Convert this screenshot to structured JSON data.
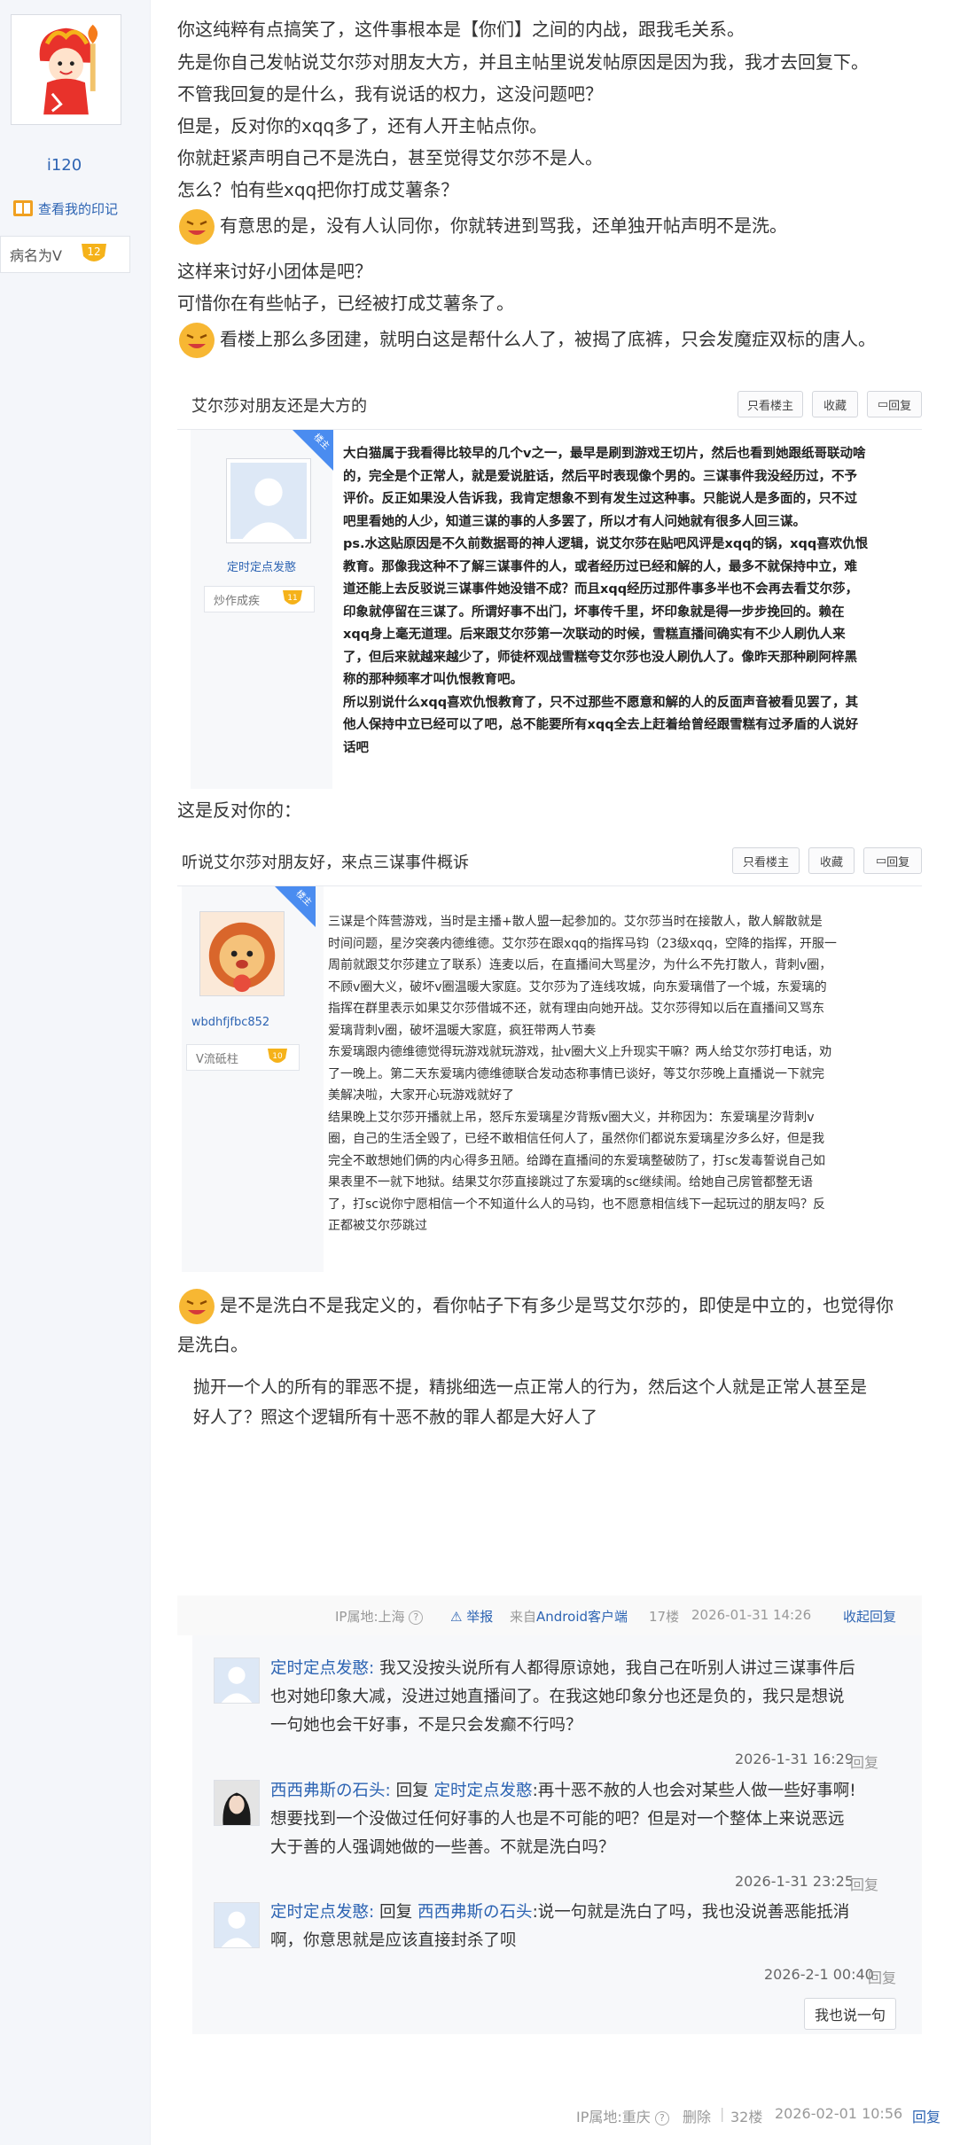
{
  "sidebar": {
    "username": "i120",
    "my_mark_link": "查看我的印记",
    "rank_title": "病名为V",
    "rank_level": "12"
  },
  "post": {
    "paragraphs": [
      "你这纯粹有点搞笑了，这件事根本是【你们】之间的内战，跟我毛关系。",
      "先是你自己发帖说艾尔莎对朋友大方，并且主帖里说发帖原因是因为我，我才去回复下。",
      "不管我回复的是什么，我有说话的权力，这没问题吧？",
      "但是，反对你的xqq多了，还有人开主帖点你。",
      "你就赶紧声明自己不是洗白，甚至觉得艾尔莎不是人。",
      "怎么？怕有些xqq把你打成艾薯条？",
      "有意思的是，没有人认同你，你就转进到骂我，还单独开帖声明不是洗。",
      "这样来讨好小团体是吧？",
      "可惜你在有些帖子，已经被打成艾薯条了。",
      "看楼上那么多团建，就明白这是帮什么人了，被揭了底裤，只会发魔症双标的唐人。",
      "这是反对你的：",
      "是不是洗白不是我定义的，看你帖子下有多少是骂艾尔莎的，即使是中立的，也觉得你",
      "是洗白。"
    ],
    "shot1": {
      "title": "艾尔莎对朋友还是大方的",
      "btn_owner": "只看楼主",
      "btn_fav": "收藏",
      "btn_reply": "回复",
      "ribbon": "楼主",
      "author": "定时定点发憨",
      "rank": "炒作成疾",
      "level": "11",
      "body": "大白猫属于我看得比较早的几个v之一，最早是刷到游戏王切片，然后也看到她跟纸哥联动啥\n的，完全是个正常人，就是爱说脏话，然后平时表现像个男的。三谋事件我没经历过，不予\n评价。反正如果没人告诉我，我肯定想象不到有发生过这种事。只能说人是多面的，只不过\n吧里看她的人少，知道三谋的事的人多罢了，所以才有人问她就有很多人回三谋。\nps.水这贴原因是不久前数据哥的神人逻辑，说艾尔莎在贴吧风评是xqq的锅，xqq喜欢仇恨\n教育。那像我这种不了解三谋事件的人，或者经历过已经和解的人，最多不就保持中立，难\n道还能上去反驳说三谋事件她没错不成？而且xqq经历过那件事多半也不会再去看艾尔莎，\n印象就停留在三谋了。所谓好事不出门，坏事传千里，坏印象就是得一步步挽回的。赖在\nxqq身上毫无道理。后来跟艾尔莎第一次联动的时候，雪糕直播间确实有不少人刷仇人来\n了，但后来就越来越少了，师徒杯观战雪糕夸艾尔莎也没人刷仇人了。像昨天那种刷阿梓黑\n称的那种频率才叫仇恨教育吧。\n所以别说什么xqq喜欢仇恨教育了，只不过那些不愿意和解的人的反面声音被看见罢了，其\n他人保持中立已经可以了吧，总不能要所有xqq全去上赶着给曾经跟雪糕有过矛盾的人说好\n话吧"
    },
    "shot2": {
      "title": "听说艾尔莎对朋友好，来点三谋事件概诉",
      "btn_owner": "只看楼主",
      "btn_fav": "收藏",
      "btn_reply": "回复",
      "ribbon": "楼主",
      "author": "wbdhfjfbc852",
      "rank": "V流砥柱",
      "level": "10",
      "body": "三谋是个阵营游戏，当时是主播+散人盟一起参加的。艾尔莎当时在接散人，散人解散就是\n时间问题，星汐突袭内德维德。艾尔莎在跟xqq的指挥马钧（23级xqq，空降的指挥，开服一\n周前就跟艾尔莎建立了联系）连麦以后，在直播间大骂星汐，为什么不先打散人，背刺v圈，\n不顾v圈大义，破坏v圈温暖大家庭。艾尔莎为了连线攻城，向东爱璃借了一个城，东爱璃的\n指挥在群里表示如果艾尔莎借城不还，就有理由向她开战。艾尔莎得知以后在直播间又骂东\n爱璃背刺v圈，破坏温暖大家庭，疯狂带两人节奏\n东爱璃跟内德维德觉得玩游戏就玩游戏，扯v圈大义上升现实干嘛？两人给艾尔莎打电话，劝\n了一晚上。第二天东爱璃内德维德联合发动态称事情已谈好，等艾尔莎晚上直播说一下就完\n美解决啦，大家开心玩游戏就好了\n结果晚上艾尔莎开播就上吊，怒斥东爱璃星汐背叛v圈大义，并称因为：东爱璃星汐背刺v\n圈，自己的生活全毁了，已经不敢相信任何人了，虽然你们都说东爱璃星汐多么好，但是我\n完全不敢想她们俩的内心得多丑陋。给蹲在直播间的东爱璃整破防了，打sc发毒誓说自己如\n果表里不一就下地狱。结果艾尔莎直接跳过了东爱璃的sc继续闹。给她自己房管都整无语\n了，打sc说你宁愿相信一个不知道什么人的马钧，也不愿意相信线下一起玩过的朋友吗？反\n正都被艾尔莎跳过"
    }
  },
  "quote": {
    "line1": "抛开一个人的所有的罪恶不提，精挑细选一点正常人的行为，然后这个人就是正常人甚至是",
    "line2": "好人了？照这个逻辑所有十恶不赦的罪人都是大好人了"
  },
  "post_meta": {
    "ip": "IP属地:上海",
    "report": "举报",
    "client": "来自Android客户端",
    "floor": "17楼",
    "time": "2026-01-31 14:26",
    "collapse": "收起回复"
  },
  "replies": [
    {
      "user": "定时定点发憨",
      "line1": "我又没按头说所有人都得原谅她，我自己在听别人讲过三谋事件后",
      "line2": "也对她印象大减，没进过她直播间了。在我这她印象分也还是负的，我只是想说",
      "line3": "一句她也会干好事，不是只会发癫不行吗？",
      "time": "2026-1-31 16:29",
      "reply_label": "回复"
    },
    {
      "user": "西西弗斯の石头",
      "reply_word": "回复",
      "target": "定时定点发憨",
      "line1": ":再十恶不赦的人也会对某些人做一些好事啊!",
      "line2": "想要找到一个没做过任何好事的人也是不可能的吧？但是对一个整体上来说恶远",
      "line3": "大于善的人强调她做的一些善。不就是洗白吗？",
      "time": "2026-1-31 23:25",
      "reply_label": "回复"
    },
    {
      "user": "定时定点发憨",
      "reply_word": "回复",
      "target": "西西弗斯の石头",
      "line1": ":说一句就是洗白了吗，我也没说善恶能抵消",
      "line2": "啊，你意思就是应该直接封杀了呗",
      "time": "2026-2-1 00:40",
      "reply_label": "回复"
    }
  ],
  "say_button": "我也说一句",
  "footer": {
    "ip": "IP属地:重庆",
    "delete": "删除",
    "floor": "32楼",
    "time": "2026-02-01 10:56",
    "reply": "回复"
  },
  "colors": {
    "link": "#2d64b3",
    "sidebar_bg": "#f4f6fa",
    "ribbon": "#4a8cf0"
  },
  "icons": [
    "fuwa-mascot-avatar",
    "mark-book-icon",
    "level-badge-icon",
    "laughing-emoji-icon",
    "default-avatar-icon",
    "lion-avatar-icon",
    "help-icon",
    "report-icon"
  ]
}
